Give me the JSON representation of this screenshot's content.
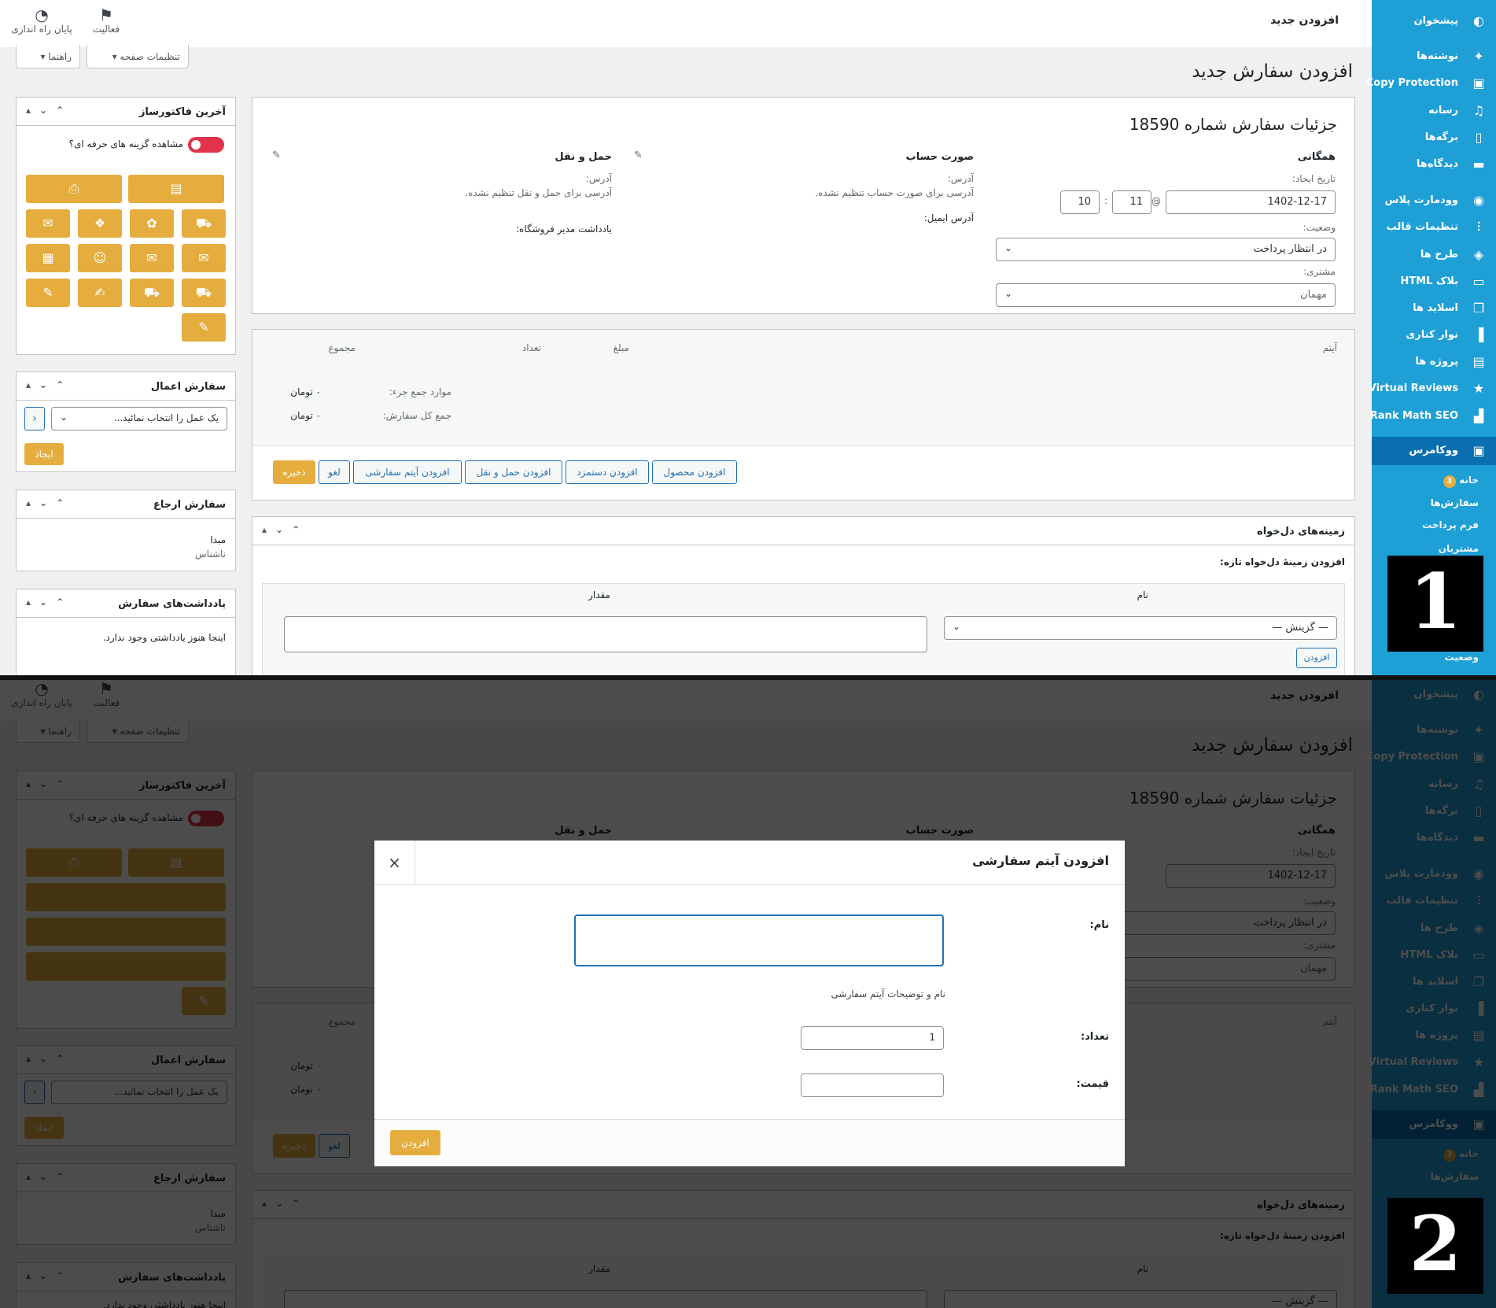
{
  "panel_markers": [
    "1",
    "2"
  ],
  "topbar": {
    "title": "افزودن جدید",
    "setup_label": "پایان راه اندازی",
    "activity_label": "فعالیت",
    "page_settings": "تنظیمات صفحه",
    "help": "راهنما"
  },
  "sidebar": {
    "items": [
      {
        "label": "پیشخوان",
        "icon": "dashboard-icon"
      },
      {
        "label": "نوشته‌ها",
        "icon": "pin-icon"
      },
      {
        "label": "Copy Protection",
        "icon": "lock-icon"
      },
      {
        "label": "رسانه",
        "icon": "media-icon"
      },
      {
        "label": "برگه‌ها",
        "icon": "pages-icon"
      },
      {
        "label": "دیدگاه‌ها",
        "icon": "comment-icon"
      },
      {
        "label": "وودمارت پلاس",
        "icon": "woodmart-icon"
      },
      {
        "label": "تنظیمات قالب",
        "icon": "sliders-icon"
      },
      {
        "label": "طرح ها",
        "icon": "layers-icon"
      },
      {
        "label": "بلاک HTML",
        "icon": "block-icon"
      },
      {
        "label": "اسلاید ها",
        "icon": "slides-icon"
      },
      {
        "label": "نوار کناری",
        "icon": "sidebar-icon"
      },
      {
        "label": "پروژه ها",
        "icon": "briefcase-icon"
      },
      {
        "label": "Virtual Reviews",
        "icon": "star-icon"
      },
      {
        "label": "Rank Math SEO",
        "icon": "chart-icon"
      },
      {
        "label": "ووکامرس",
        "icon": "woo-icon"
      }
    ],
    "sub_items": [
      "خانه",
      "سفارش‌ها",
      "فرم پرداخت",
      "مشتریان",
      "وضعیت"
    ],
    "home_badge": "3"
  },
  "page": {
    "heading": "افزودن سفارش جدید",
    "order_title": "جزئیات سفارش شماره 18590",
    "general": {
      "heading": "همگانی",
      "date_label": "تاریخ ایجاد:",
      "date_value": "1402-12-17",
      "at": "@",
      "hour": "11",
      "colon": ":",
      "minute": "10",
      "status_label": "وضعیت:",
      "status_value": "در انتظار پرداخت",
      "customer_label": "مشتری:",
      "customer_value": "مهمان"
    },
    "billing": {
      "heading": "صورت حساب",
      "address_label": "آدرس:",
      "address_value": "آدرسی برای صورت حساب تنظیم نشده.",
      "email_label": "آدرس ایمیل:"
    },
    "shipping": {
      "heading": "حمل و نقل",
      "address_label": "آدرس:",
      "address_value": "آدرسی برای حمل و نقل تنظیم نشده.",
      "note_label": "یادداشت مدیر فروشگاه:"
    },
    "items": {
      "col_item": "آیتم",
      "col_price": "مبلغ",
      "col_qty": "تعداد",
      "col_total": "مجموع",
      "subtotal_label": "موارد جمع جزء:",
      "subtotal_value": "۰ تومان",
      "total_label": "جمع کل سفارش:",
      "total_value": "۰ تومان"
    },
    "buttons": {
      "add_product": "افزودن محصول",
      "add_fee": "افزودن دستمزد",
      "add_shipping": "افزودن حمل و نقل",
      "add_custom": "افزودن آیتم سفارشی",
      "cancel": "لغو",
      "save": "ذخیره"
    },
    "custom_fields": {
      "heading": "زمینه‌های دل‌خواه",
      "add_new": "افزودن زمینهٔ دل‌خواه تازه:",
      "col_name": "نام",
      "col_value": "مقدار",
      "select_placeholder": "— گزینش —",
      "add_btn": "افزودن"
    }
  },
  "left": {
    "invoice_box": {
      "heading": "آخرین فاکتورساز",
      "pro_toggle": "مشاهده گزینه های حرفه ای؟"
    },
    "actions_box": {
      "heading": "سفارش اعمال",
      "select": "یک عمل را انتخاب نمائید...",
      "go": "‹",
      "create": "ایجاد"
    },
    "source_box": {
      "heading": "سفارش ارجاع",
      "origin_label": "مبدا",
      "origin_value": "ناشناس"
    },
    "notes_box": {
      "heading": "یادداشت‌های سفارش",
      "empty": "اینجا هنوز یادداشتی وجود ندارد."
    }
  },
  "modal": {
    "title": "افزودن آیتم سفارشی",
    "close": "×",
    "name_label": "نام:",
    "name_help": "نام و توضیحات آیتم سفارشی",
    "qty_label": "تعداد:",
    "qty_value": "1",
    "price_label": "قیمت:",
    "submit": "افزودن"
  },
  "colors": {
    "sidebar": "#1e9fd6",
    "accent": "#e5ad3e",
    "link": "#2271b1",
    "toggle": "#e2334c"
  }
}
